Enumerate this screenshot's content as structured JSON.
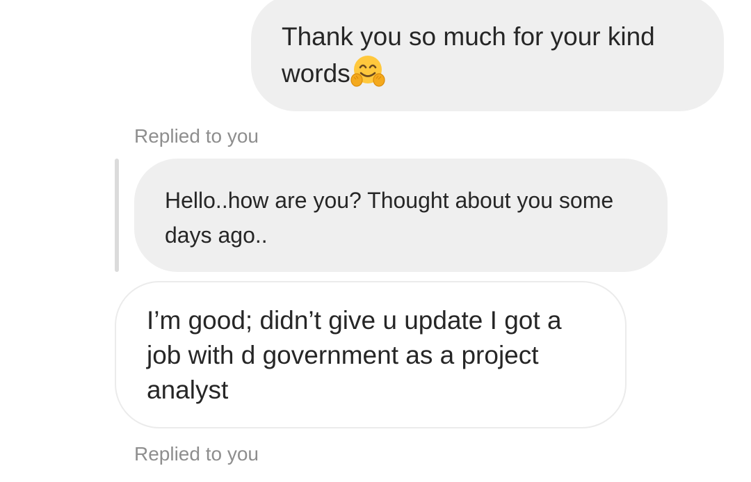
{
  "messages": {
    "sent": {
      "text": "Thank you so much for your kind words",
      "emoji": "hugging-face-icon"
    },
    "reply_label_1": "Replied to you",
    "quoted": {
      "text": "Hello..how are you? Thought about you some days ago.."
    },
    "received": {
      "text": "I’m good; didn’t give u update I got a job with d government as a project analyst"
    },
    "reply_label_2": "Replied to you"
  },
  "colors": {
    "bubble_gray": "#efefef",
    "label_gray": "#8e8e8e",
    "reply_bar": "#dbdbdb",
    "text": "#262626",
    "emoji_yellow": "#ffc83d"
  }
}
